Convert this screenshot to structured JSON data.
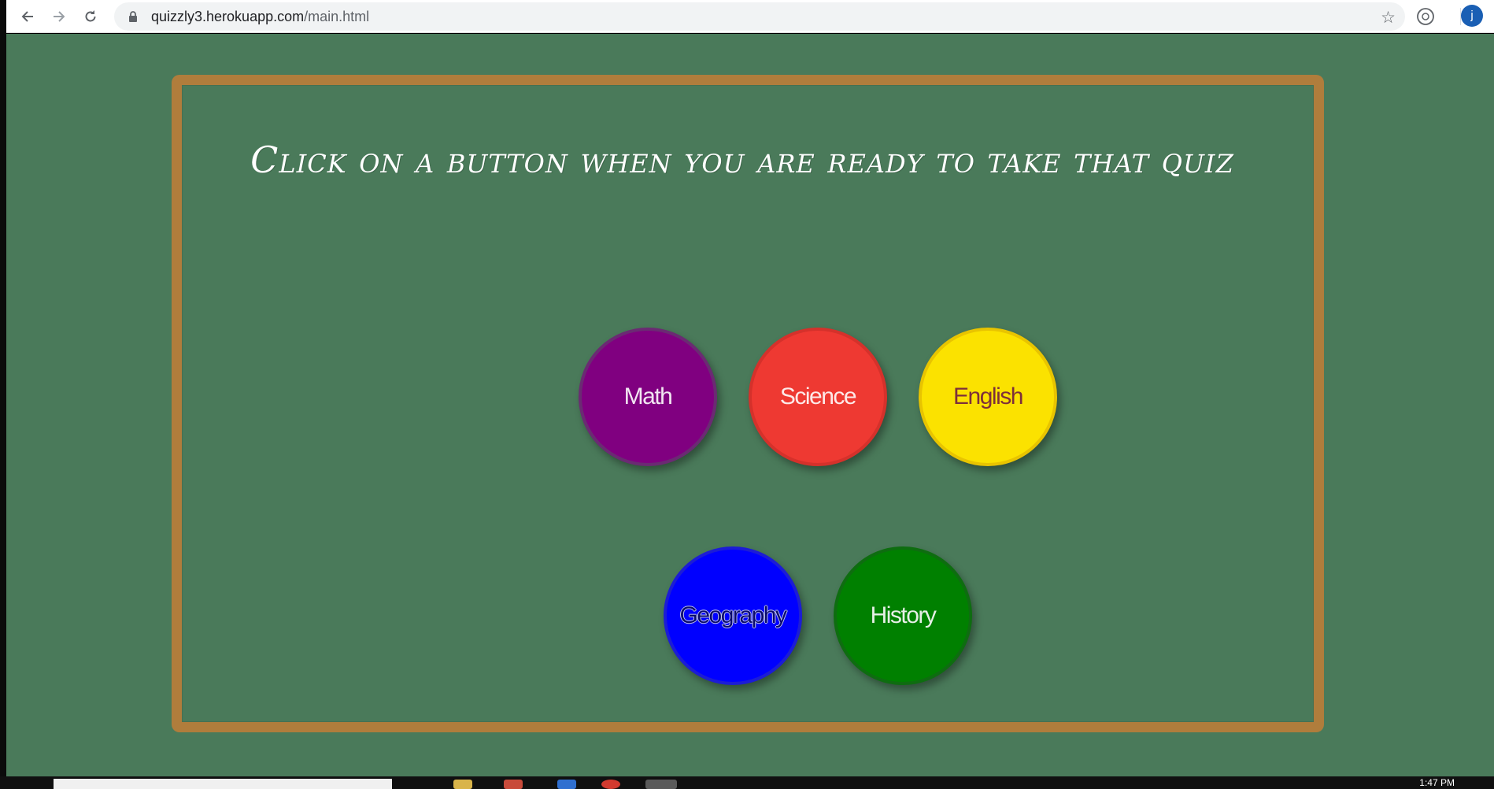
{
  "browser": {
    "url_domain": "quizzly3.herokuapp.com",
    "url_path": "/main.html",
    "profile_initial": "j",
    "back_icon": "back-arrow-icon",
    "forward_icon": "forward-arrow-icon",
    "reload_icon": "reload-icon",
    "bookmark_icon": "star-icon"
  },
  "page": {
    "heading": "Click on a button when you are ready to take that quiz",
    "background_color": "#4a7a5a",
    "frame_color": "#b07d3c"
  },
  "quizzes": [
    {
      "label": "Math",
      "color": "#800080"
    },
    {
      "label": "Science",
      "color": "#ee3932"
    },
    {
      "label": "English",
      "color": "#fbe200"
    },
    {
      "label": "Geography",
      "color": "#0000ff"
    },
    {
      "label": "History",
      "color": "#008000"
    }
  ],
  "taskbar": {
    "time": "1:47 PM"
  }
}
